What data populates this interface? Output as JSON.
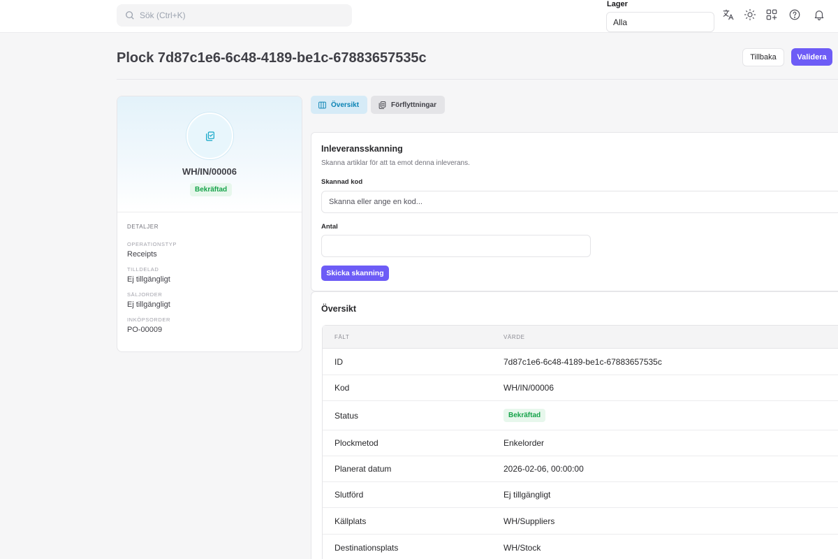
{
  "topbar": {
    "search_placeholder": "Sök (Ctrl+K)",
    "lager_label": "Lager",
    "lager_value": "Alla",
    "icons": [
      "translate-icon",
      "sun-icon",
      "apps-icon",
      "help-icon",
      "bell-icon"
    ]
  },
  "header": {
    "title": "Plock 7d87c1e6-6c48-4189-be1c-67883657535c",
    "back_label": "Tillbaka",
    "validate_label": "Validera"
  },
  "summary": {
    "code": "WH/IN/00006",
    "status": "Bekräftad",
    "details_title": "DETALJER",
    "details": [
      {
        "label": "OPERATIONSTYP",
        "value": "Receipts"
      },
      {
        "label": "TILLDELAD",
        "value": "Ej tillgängligt"
      },
      {
        "label": "SÄLJORDER",
        "value": "Ej tillgängligt"
      },
      {
        "label": "INKÖPSORDER",
        "value": "PO-00009"
      }
    ]
  },
  "tabs": [
    {
      "label": "Översikt"
    },
    {
      "label": "Förflyttningar"
    }
  ],
  "scan": {
    "title": "Inleveransskanning",
    "subtitle": "Skanna artiklar för att ta emot denna inleverans.",
    "code_label": "Skannad kod",
    "code_placeholder": "Skanna eller ange en kod...",
    "qty_label": "Antal",
    "submit_label": "Skicka skanning"
  },
  "overview": {
    "title": "Översikt",
    "col_field": "FÄLT",
    "col_value": "VÄRDE",
    "rows": [
      {
        "field": "ID",
        "value": "7d87c1e6-6c48-4189-be1c-67883657535c"
      },
      {
        "field": "Kod",
        "value": "WH/IN/00006"
      },
      {
        "field": "Status",
        "value": "Bekräftad"
      },
      {
        "field": "Plockmetod",
        "value": "Enkelorder"
      },
      {
        "field": "Planerat datum",
        "value": "2026-02-06, 00:00:00"
      },
      {
        "field": "Slutförd",
        "value": "Ej tillgängligt"
      },
      {
        "field": "Källplats",
        "value": "WH/Suppliers"
      },
      {
        "field": "Destinationsplats",
        "value": "WH/Stock"
      }
    ]
  }
}
